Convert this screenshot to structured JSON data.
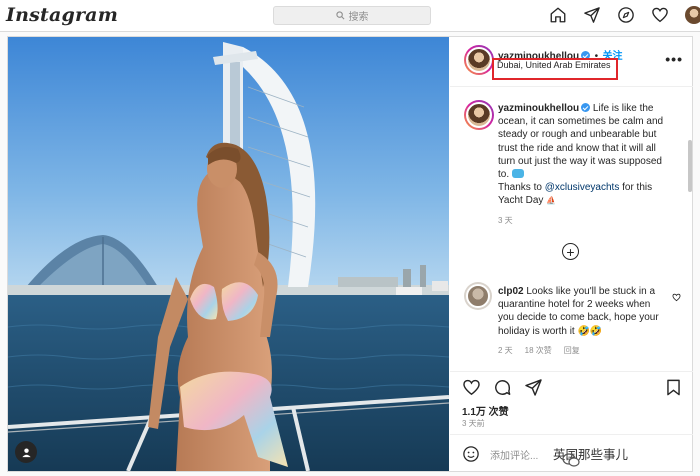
{
  "topbar": {
    "logo": "Instagram",
    "search_placeholder": "搜索"
  },
  "post": {
    "username": "yazminoukhellou",
    "follow_label": "关注",
    "location": "Dubai, United Arab Emirates",
    "more_label": "•••",
    "caption": {
      "username": "yazminoukhellou",
      "line1": "Life is like the ocean, it can sometimes be calm and steady or rough and unbearable but trust the ride and know that it will all turn out just the way it was supposed to.",
      "line2": "Thanks to ",
      "mention": "@xclusiveyachts",
      "line3": " for this Yacht Day",
      "time": "3 天"
    },
    "load_more": "+",
    "comment": {
      "username": "clp02",
      "text": "Looks like you'll be stuck in a quarantine hotel for 2 weeks when you decide to come back, hope your holiday is worth it",
      "emoji": "🤣🤣",
      "time": "2 天",
      "likes": "18 次赞",
      "reply": "回复"
    },
    "likes": "1.1万 次赞",
    "posted_ago": "3 天前",
    "add_comment_placeholder": "添加评论...",
    "watermark": "英国那些事儿"
  },
  "colors": {
    "accent": "#0095f6",
    "highlight_box": "#e0262b",
    "verified": "#3897f0"
  }
}
